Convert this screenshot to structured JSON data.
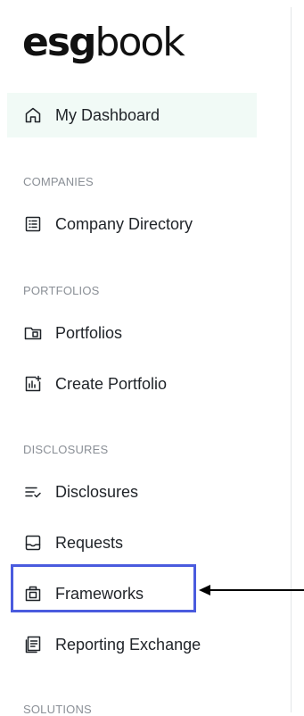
{
  "brand": {
    "logo_bold": "esg",
    "logo_light": "book"
  },
  "nav": {
    "dashboard": {
      "label": "My Dashboard",
      "icon": "home-icon",
      "active": true
    },
    "sections": [
      {
        "header": "COMPANIES",
        "items": [
          {
            "label": "Company Directory",
            "icon": "list-icon"
          }
        ]
      },
      {
        "header": "PORTFOLIOS",
        "items": [
          {
            "label": "Portfolios",
            "icon": "folder-icon"
          },
          {
            "label": "Create Portfolio",
            "icon": "chart-add-icon"
          }
        ]
      },
      {
        "header": "DISCLOSURES",
        "items": [
          {
            "label": "Disclosures",
            "icon": "checklist-icon"
          },
          {
            "label": "Requests",
            "icon": "inbox-icon"
          },
          {
            "label": "Frameworks",
            "icon": "framework-icon"
          },
          {
            "label": "Reporting Exchange",
            "icon": "document-icon"
          }
        ]
      },
      {
        "header": "SOLUTIONS",
        "items": []
      }
    ]
  },
  "annotation": {
    "highlight_color": "#4a5bde",
    "arrow_color": "#000000"
  },
  "colors": {
    "active_background": "#f1faf6",
    "text": "#1f2328",
    "section_header": "#8a8f96"
  }
}
